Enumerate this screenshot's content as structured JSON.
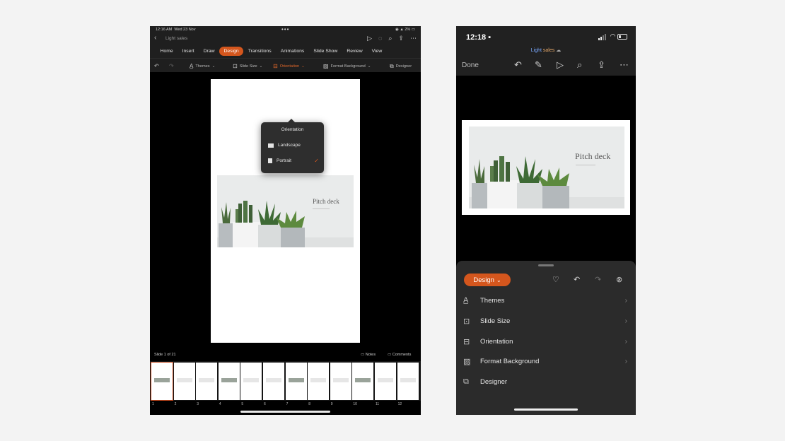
{
  "ipad": {
    "status": {
      "time": "12:16 AM",
      "date": "Wed 23 Nov",
      "battery": "2%"
    },
    "doc_name": "Light sales",
    "tabs": [
      {
        "label": "Home",
        "active": false
      },
      {
        "label": "Insert",
        "active": false
      },
      {
        "label": "Draw",
        "active": false
      },
      {
        "label": "Design",
        "active": true
      },
      {
        "label": "Transitions",
        "active": false
      },
      {
        "label": "Animations",
        "active": false
      },
      {
        "label": "Slide Show",
        "active": false
      },
      {
        "label": "Review",
        "active": false
      },
      {
        "label": "View",
        "active": false
      }
    ],
    "tools": {
      "themes": "Themes",
      "slide_size": "Slide Size",
      "orientation": "Orientation",
      "format_background": "Format Background",
      "designer": "Designer"
    },
    "popover": {
      "title": "Orientation",
      "options": [
        {
          "label": "Landscape",
          "selected": false
        },
        {
          "label": "Portrait",
          "selected": true
        }
      ]
    },
    "slide_title": "Pitch deck",
    "slide_counter": "Slide 1 of 21",
    "notes_label": "Notes",
    "comments_label": "Comments",
    "thumbnails": [
      "1",
      "2",
      "3",
      "4",
      "5",
      "6",
      "7",
      "8",
      "9",
      "10",
      "11",
      "12"
    ]
  },
  "iphone": {
    "status": {
      "time": "12:18"
    },
    "doc_name_part1": "Light",
    "doc_name_part2": " sales",
    "done_label": "Done",
    "slide_title": "Pitch deck",
    "sheet": {
      "tab_label": "Design",
      "items": [
        {
          "label": "Themes",
          "icon": "themes-icon",
          "has_chevron": true
        },
        {
          "label": "Slide Size",
          "icon": "slide-size-icon",
          "has_chevron": true
        },
        {
          "label": "Orientation",
          "icon": "orientation-icon",
          "has_chevron": true
        },
        {
          "label": "Format Background",
          "icon": "format-background-icon",
          "has_chevron": true
        },
        {
          "label": "Designer",
          "icon": "designer-icon",
          "has_chevron": false
        }
      ]
    }
  },
  "colors": {
    "accent": "#d4561d",
    "dark_bg": "#1f1f1f",
    "sheet_bg": "#2b2b2b"
  }
}
